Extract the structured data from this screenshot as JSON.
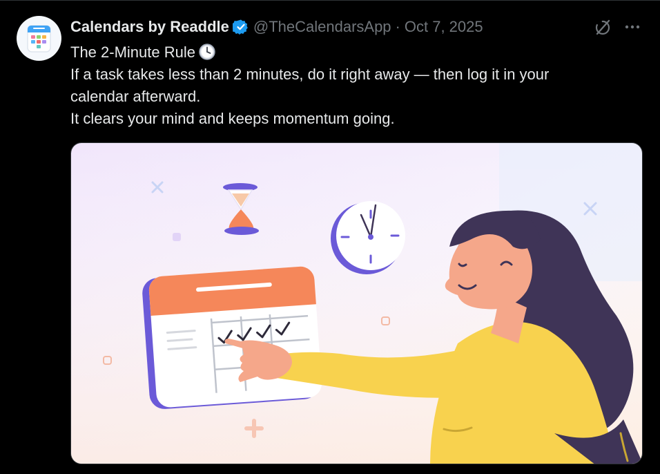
{
  "post": {
    "author_name": "Calendars by Readdle",
    "handle": "@TheCalendarsApp",
    "separator": "·",
    "date": "Oct 7, 2025",
    "title": "The 2-Minute Rule",
    "body_line_1": "If a task takes less than 2 minutes, do it right away — then log it in your",
    "body_line_2": "calendar afterward.",
    "body_line_3": "It clears your mind and keeps momentum going."
  },
  "icons": {
    "verified": "verified-badge-icon",
    "grok": "grok-icon",
    "more": "more-icon",
    "title_emoji": "clock-emoji-icon"
  },
  "colors": {
    "background": "#000000",
    "text_primary": "#e7e9ea",
    "text_secondary": "#71767b",
    "verified_blue": "#1d9bf0",
    "illustration_orange": "#f5875a",
    "illustration_purple": "#6b5ad8",
    "illustration_yellow": "#f8d24e",
    "illustration_hair": "#3f3457"
  }
}
